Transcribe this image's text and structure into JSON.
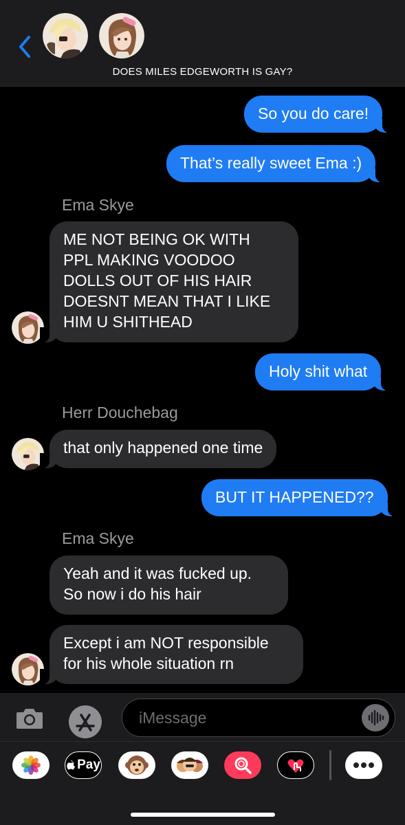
{
  "header": {
    "title": "DOES MILES EDGEWORTH IS GAY?",
    "back_icon": "chevron-left-icon",
    "members": [
      "Herr Douchebag",
      "Ema Skye"
    ]
  },
  "messages": [
    {
      "from": "me",
      "text": "So you do care!"
    },
    {
      "from": "me",
      "text": "That’s really sweet Ema :)"
    },
    {
      "from": "Ema Skye",
      "sender_label": "Ema Skye",
      "lines": [
        "ME NOT BEING OK WITH",
        "PPL MAKING VOODOO",
        "DOLLS OUT OF HIS HAIR",
        "DOESNT MEAN THAT I LIKE",
        "HIM U SHITHEAD"
      ]
    },
    {
      "from": "me",
      "text": "Holy shit what"
    },
    {
      "from": "Herr Douchebag",
      "sender_label": "Herr Douchebag",
      "text": "that only happened one time"
    },
    {
      "from": "me",
      "text": "BUT IT HAPPENED??"
    },
    {
      "from": "Ema Skye",
      "sender_label": "Ema Skye",
      "lines": [
        "Yeah and it was fucked up.",
        "So now i do his hair"
      ]
    },
    {
      "from": "Ema Skye",
      "lines": [
        "Except i am NOT responsible",
        "for his whole situation rn"
      ]
    }
  ],
  "input": {
    "placeholder": "iMessage",
    "camera_icon": "camera-icon",
    "appstore_icon": "app-store-icon",
    "audio_icon": "audio-waveform-icon"
  },
  "drawer": {
    "apps": [
      "photos-icon",
      "apple-pay-icon",
      "animoji-icon",
      "memoji-icon",
      "image-search-icon",
      "digital-touch-icon",
      "more-icon"
    ],
    "apple_pay_label": "Pay"
  },
  "colors": {
    "sent_bubble": "#1f7cf3",
    "received_bubble": "#2c2c2e",
    "background": "#000000",
    "bar": "#1c1c1e"
  }
}
